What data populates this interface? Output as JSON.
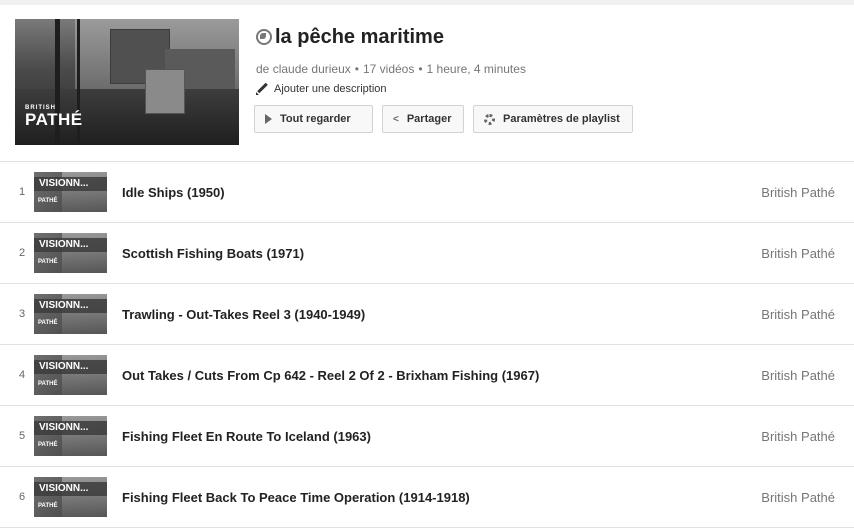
{
  "playlist": {
    "title": "la pêche maritime",
    "owner_prefix": "de",
    "owner": "claude durieux",
    "video_count": "17 vidéos",
    "duration": "1 heure, 4 minutes",
    "add_description": "Ajouter une description",
    "cover_logo_top": "BRITISH",
    "cover_logo_bottom": "PATHÉ"
  },
  "buttons": {
    "play_all": "Tout regarder",
    "share": "Partager",
    "settings": "Paramètres de playlist"
  },
  "icons": {
    "privacy": "globe-icon",
    "edit": "pencil-icon",
    "play": "play-icon",
    "share": "share-icon",
    "settings": "gear-icon"
  },
  "videos": [
    {
      "index": "1",
      "title": "Idle Ships (1950)",
      "channel": "British Pathé",
      "thumb_label": "VISIONN...",
      "thumb_logo": "PATHÉ"
    },
    {
      "index": "2",
      "title": "Scottish Fishing Boats (1971)",
      "channel": "British Pathé",
      "thumb_label": "VISIONN...",
      "thumb_logo": "PATHÉ"
    },
    {
      "index": "3",
      "title": "Trawling - Out-Takes Reel 3 (1940-1949)",
      "channel": "British Pathé",
      "thumb_label": "VISIONN...",
      "thumb_logo": "PATHÉ"
    },
    {
      "index": "4",
      "title": "Out Takes / Cuts From Cp 642 - Reel 2 Of 2 - Brixham Fishing (1967)",
      "channel": "British Pathé",
      "thumb_label": "VISIONN...",
      "thumb_logo": "PATHÉ"
    },
    {
      "index": "5",
      "title": "Fishing Fleet En Route To Iceland (1963)",
      "channel": "British Pathé",
      "thumb_label": "VISIONN...",
      "thumb_logo": "PATHÉ"
    },
    {
      "index": "6",
      "title": "Fishing Fleet Back To Peace Time Operation (1914-1918)",
      "channel": "British Pathé",
      "thumb_label": "VISIONN...",
      "thumb_logo": "PATHÉ"
    }
  ]
}
